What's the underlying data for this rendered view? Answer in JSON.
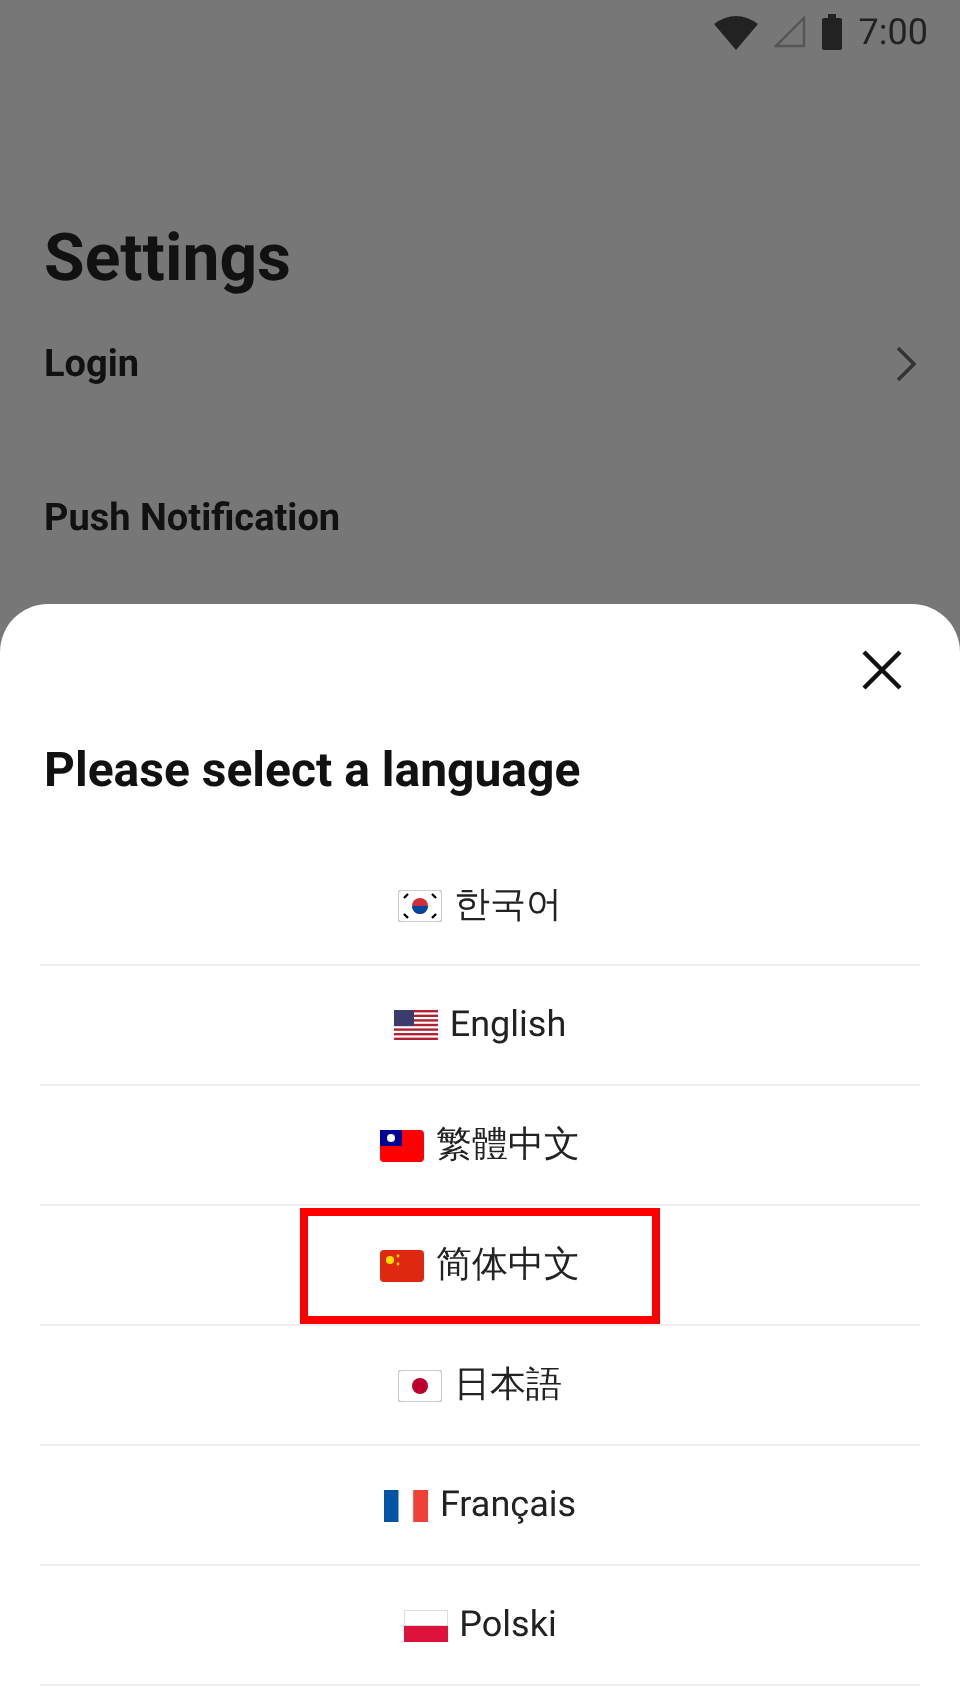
{
  "status_bar": {
    "time": "7:00"
  },
  "page": {
    "title": "Settings",
    "items": [
      {
        "label": "Login"
      },
      {
        "label": "Push Notification"
      }
    ]
  },
  "sheet": {
    "title": "Please select a language",
    "languages": [
      {
        "label": "한국어",
        "kind": "korea",
        "highlighted": false
      },
      {
        "label": "English",
        "kind": "usa",
        "highlighted": false
      },
      {
        "label": "繁體中文",
        "kind": "taiwan",
        "highlighted": false
      },
      {
        "label": "简体中文",
        "kind": "china",
        "highlighted": true
      },
      {
        "label": "日本語",
        "kind": "japan",
        "highlighted": false
      },
      {
        "label": "Français",
        "kind": "france",
        "highlighted": false
      },
      {
        "label": "Polski",
        "kind": "poland",
        "highlighted": false
      }
    ]
  }
}
